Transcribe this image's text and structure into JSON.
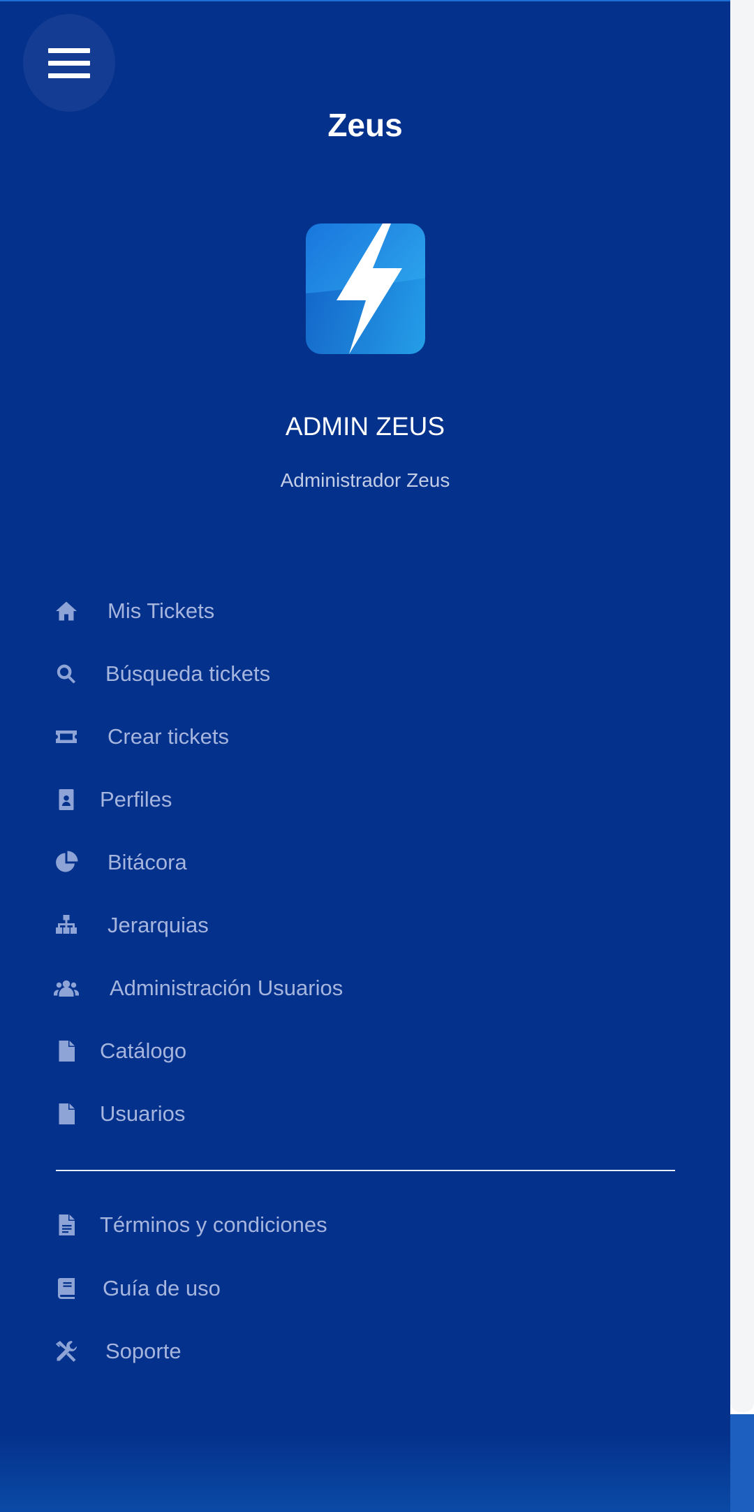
{
  "header": {
    "title": "Zeus",
    "menu_icon": "hamburger-menu-icon"
  },
  "logo": {
    "icon": "lightning-bolt-logo",
    "colors": {
      "light": "#33b3f0",
      "dark": "#0a5cc8",
      "bolt": "#ffffff"
    }
  },
  "user": {
    "name": "ADMIN ZEUS",
    "role": "Administrador Zeus"
  },
  "nav": {
    "items": [
      {
        "label": "Mis Tickets",
        "icon": "home-icon"
      },
      {
        "label": "Búsqueda tickets",
        "icon": "search-icon"
      },
      {
        "label": "Crear tickets",
        "icon": "ticket-icon"
      },
      {
        "label": "Perfiles",
        "icon": "id-badge-icon"
      },
      {
        "label": "Bitácora",
        "icon": "pie-chart-icon"
      },
      {
        "label": "Jerarquias",
        "icon": "org-chart-icon"
      },
      {
        "label": "Administración Usuarios",
        "icon": "users-icon"
      },
      {
        "label": "Catálogo",
        "icon": "file-icon"
      },
      {
        "label": "Usuarios",
        "icon": "file-icon"
      }
    ],
    "secondary": [
      {
        "label": "Términos y condiciones",
        "icon": "file-text-icon"
      },
      {
        "label": "Guía de uso",
        "icon": "book-icon"
      },
      {
        "label": "Soporte",
        "icon": "tools-icon"
      }
    ]
  },
  "colors": {
    "drawer_background": "#04318c",
    "menu_text": "#a6b5dd",
    "menu_icon": "#8ea3d6",
    "title_text": "#ffffff"
  }
}
